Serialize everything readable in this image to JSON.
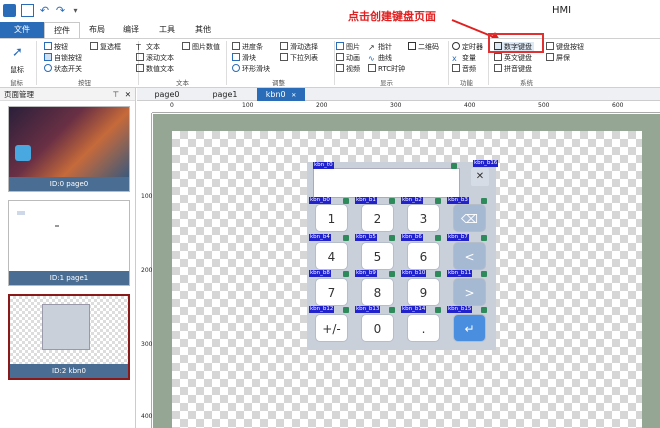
{
  "app": {
    "title": "HMI"
  },
  "quick_access": [
    "app-logo-icon",
    "save-icon",
    "undo-icon",
    "redo-icon",
    "dropdown-icon"
  ],
  "tabs": [
    "文件",
    "控件",
    "布局",
    "编译",
    "工具",
    "其他"
  ],
  "ribbon": {
    "mouse": {
      "label": "鼠标",
      "group": "鼠标"
    },
    "buttons": {
      "items": [
        "按钮",
        "复选框",
        "自锁按钮",
        "状态开关"
      ],
      "group": "按钮"
    },
    "text": {
      "items": [
        "文本",
        "图片数值",
        "滚动文本",
        "数值文本"
      ],
      "group": "文本"
    },
    "adjust": {
      "items": [
        "进度条",
        "滑动选择",
        "滑块",
        "下拉列表",
        "环形滑块"
      ],
      "group": "调整"
    },
    "display": {
      "items": [
        "图片",
        "指针",
        "二维码",
        "动画",
        "曲线",
        "视频",
        "RTC时钟"
      ],
      "group": "显示"
    },
    "function": {
      "items": [
        "定时器",
        "变量",
        "音频"
      ],
      "group": "功能"
    },
    "system": {
      "items": [
        "数字键盘",
        "键盘按钮",
        "英文键盘",
        "屏保",
        "拼音键盘"
      ],
      "group": "系统"
    }
  },
  "annotation": "点击创建键盘页面",
  "panel": {
    "title": "页面管理",
    "pin": "⊤",
    "close": "✕",
    "pages": [
      {
        "caption": "ID:0 page0"
      },
      {
        "caption": "ID:1 page1"
      },
      {
        "caption": "ID:2 kbn0"
      }
    ]
  },
  "page_tabs": [
    {
      "label": "page0"
    },
    {
      "label": "page1"
    },
    {
      "label": "kbn0",
      "close": "✕"
    }
  ],
  "ruler": {
    "h": [
      "0",
      "100",
      "200",
      "300",
      "400",
      "500",
      "600"
    ],
    "v": [
      "100",
      "200",
      "300",
      "400"
    ]
  },
  "keyboard": {
    "labels": {
      "t0": "kbn_t0",
      "b16": "kbn_b16",
      "b0": "kbn_b0",
      "b1": "kbn_b1",
      "b2": "kbn_b2",
      "b3": "kbn_b3",
      "b4": "kbn_b4",
      "b5": "kbn_b5",
      "b6": "kbn_b6",
      "b7": "kbn_b7",
      "b8": "kbn_b8",
      "b9": "kbn_b9",
      "b10": "kbn_b10",
      "b11": "kbn_b11",
      "b12": "kbn_b12",
      "b13": "kbn_b13",
      "b14": "kbn_b14",
      "b15": "kbn_b15"
    },
    "close_label": "✕",
    "keys": [
      {
        "t": "1"
      },
      {
        "t": "2"
      },
      {
        "t": "3"
      },
      {
        "t": "⌫"
      },
      {
        "t": "4"
      },
      {
        "t": "5"
      },
      {
        "t": "6"
      },
      {
        "t": "<"
      },
      {
        "t": "7"
      },
      {
        "t": "8"
      },
      {
        "t": "9"
      },
      {
        "t": ">"
      },
      {
        "t": "+/-"
      },
      {
        "t": "0"
      },
      {
        "t": "."
      },
      {
        "t": "↵"
      }
    ]
  },
  "colors": {
    "accent": "#2b6cb8",
    "annotation": "#e02020",
    "workspace": "#96a694",
    "enter_key": "#4a8ee0",
    "op_key": "#a6b9d2"
  }
}
